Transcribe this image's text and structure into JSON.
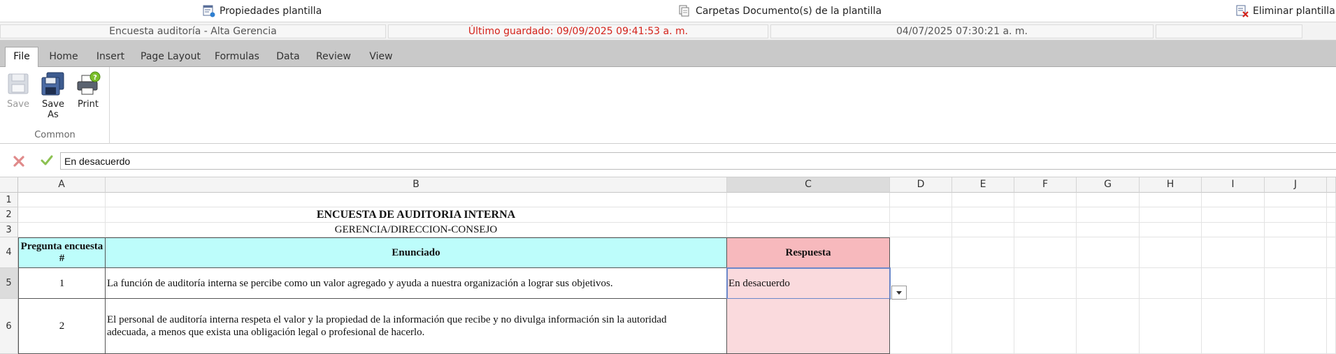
{
  "topbar": {
    "template_properties": "Propiedades plantilla",
    "template_folders": "Carpetas Documento(s) de la plantilla",
    "delete_template": "Eliminar plantilla"
  },
  "status": {
    "document_name": "Encuesta auditoría - Alta Gerencia",
    "last_saved": "Último guardado: 09/09/2025 09:41:53 a. m.",
    "date": "04/07/2025 07:30:21 a. m.",
    "extra": ""
  },
  "ribbon": {
    "tabs": [
      "File",
      "Home",
      "Insert",
      "Page Layout",
      "Formulas",
      "Data",
      "Review",
      "View"
    ],
    "active_tab": "File",
    "group_label": "Common",
    "save": "Save",
    "save_as": "Save As",
    "print": "Print"
  },
  "formula_bar": {
    "value": "En desacuerdo"
  },
  "columns": [
    "A",
    "B",
    "C",
    "D",
    "E",
    "F",
    "G",
    "H",
    "I",
    "J"
  ],
  "selected_column": "C",
  "rows": [
    "1",
    "2",
    "3",
    "4",
    "5",
    "6"
  ],
  "selected_row": "5",
  "sheet": {
    "title": "ENCUESTA DE AUDITORIA INTERNA",
    "subtitle": "GERENCIA/DIRECCION-CONSEJO",
    "header_question_number": "Pregunta encuesta #",
    "header_statement": "Enunciado",
    "header_answer": "Respuesta",
    "items": [
      {
        "number": "1",
        "statement": "La función de auditoría interna se percibe como un valor agregado y ayuda a nuestra organización a lograr sus objetivos.",
        "answer": "En desacuerdo"
      },
      {
        "number": "2",
        "statement": "El personal de auditoría interna respeta el valor y la propiedad de la información que recibe y no divulga información sin la autoridad adecuada, a menos que exista una obligación legal o profesional de hacerlo.",
        "answer": ""
      }
    ]
  },
  "colors": {
    "header_cyan": "#bdfdfb",
    "header_pink": "#f7b9bd",
    "answer_pink": "#fadadd",
    "saved_red": "#d4231b",
    "selection_blue": "#6b87c9"
  }
}
